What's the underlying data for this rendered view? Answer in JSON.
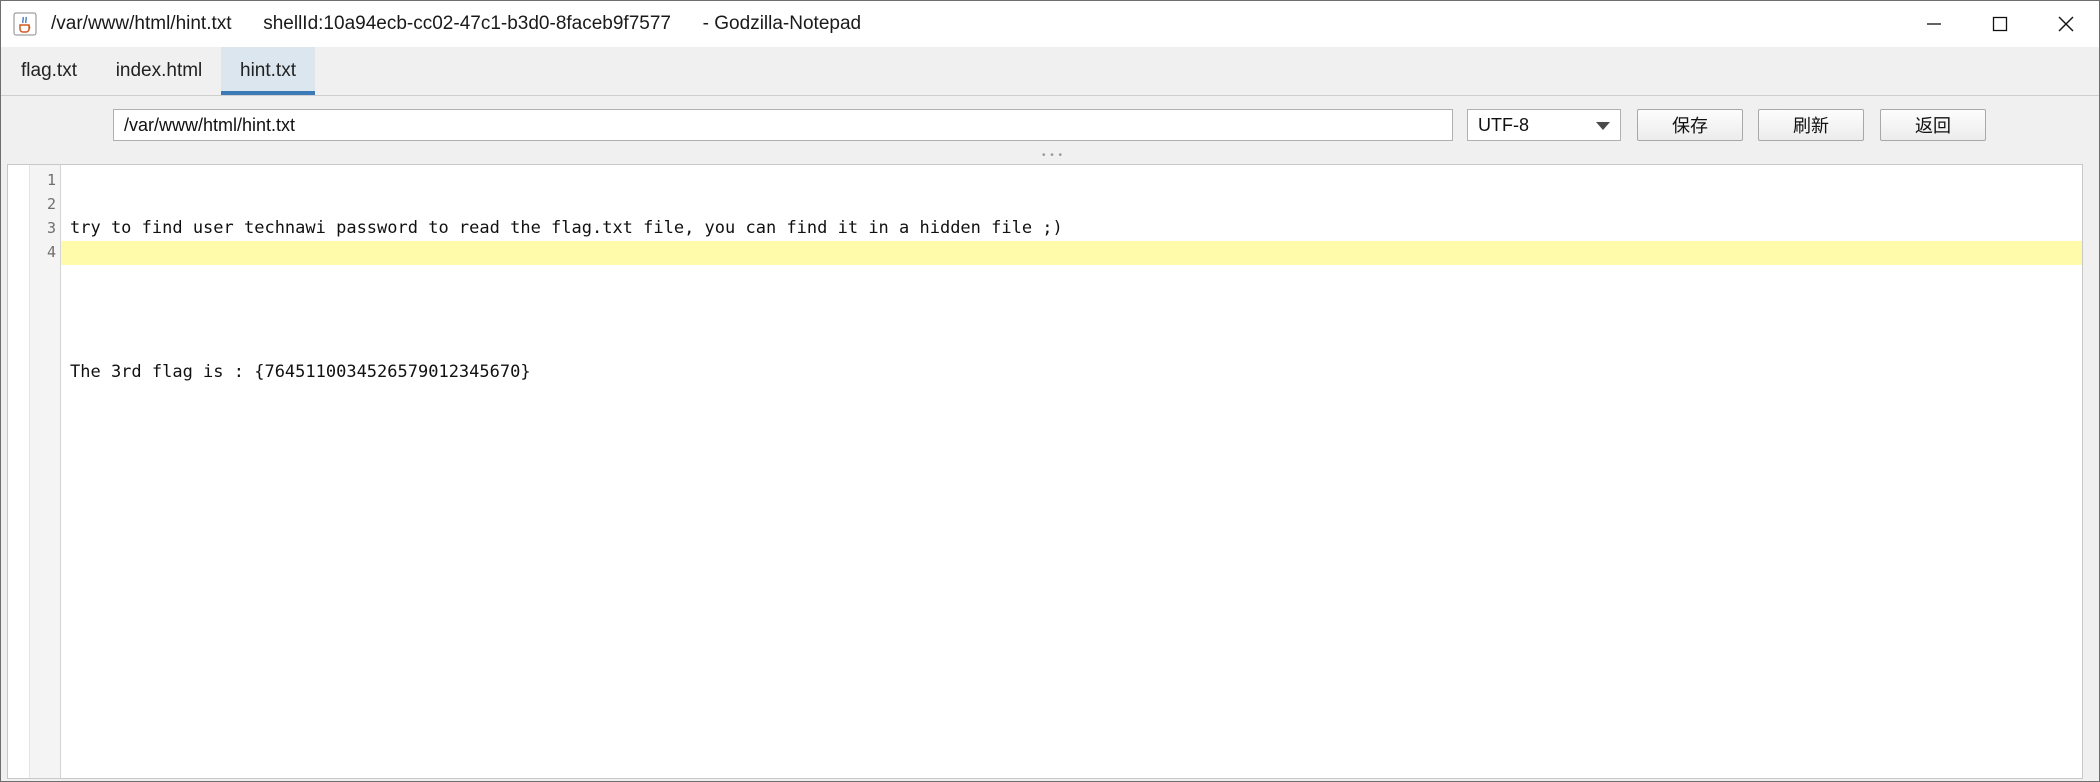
{
  "window": {
    "title_path": "/var/www/html/hint.txt",
    "title_shell": "shellId:10a94ecb-cc02-47c1-b3d0-8faceb9f7577",
    "title_app": "- Godzilla-Notepad",
    "app_icon": "java-cup-icon",
    "controls": [
      "minimize-icon",
      "maximize-icon",
      "close-icon"
    ]
  },
  "tabs": [
    {
      "label": "flag.txt",
      "active": false
    },
    {
      "label": "index.html",
      "active": false
    },
    {
      "label": "hint.txt",
      "active": true
    }
  ],
  "toolbar": {
    "path_value": "/var/www/html/hint.txt",
    "encoding": "UTF-8",
    "save_label": "保存",
    "refresh_label": "刷新",
    "back_label": "返回"
  },
  "editor": {
    "line_numbers": [
      "1",
      "2",
      "3",
      "4"
    ],
    "lines": [
      "try to find user technawi password to read the flag.txt file, you can find it in a hidden file ;)",
      "",
      "The 3rd flag is : {7645110034526579012345670}",
      ""
    ],
    "current_line": 4,
    "current_line_color": "#fffbab"
  },
  "colors": {
    "active_tab_bg": "#dce6ef",
    "active_tab_accent": "#3d7ab8",
    "window_bg": "#f0f0f0"
  }
}
